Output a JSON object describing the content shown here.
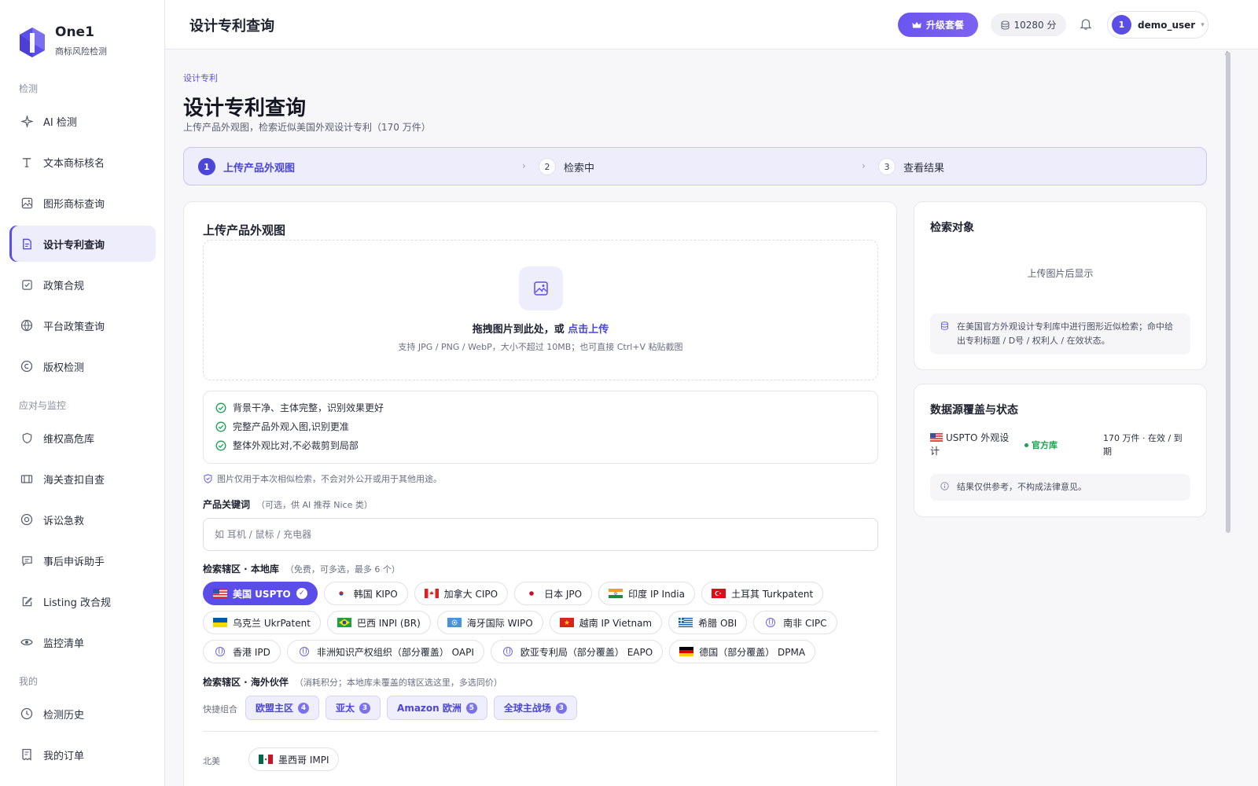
{
  "app": {
    "name": "One1",
    "subtitle": "商标风险检测"
  },
  "sidebar": {
    "groups": [
      {
        "title": "检测",
        "items": [
          {
            "label": "AI 检测",
            "icon": "sparkle-icon"
          },
          {
            "label": "文本商标核名",
            "icon": "text-icon"
          },
          {
            "label": "图形商标查询",
            "icon": "image-icon"
          },
          {
            "label": "设计专利查询",
            "icon": "document-icon",
            "active": true
          },
          {
            "label": "政策合规",
            "icon": "checklist-icon"
          },
          {
            "label": "平台政策查询",
            "icon": "globe-icon"
          },
          {
            "label": "版权检测",
            "icon": "copyright-icon"
          }
        ]
      },
      {
        "title": "应对与监控",
        "items": [
          {
            "label": "维权高危库",
            "icon": "shield-icon"
          },
          {
            "label": "海关查扣自查",
            "icon": "customs-icon"
          },
          {
            "label": "诉讼急救",
            "icon": "lifebuoy-icon"
          },
          {
            "label": "事后申诉助手",
            "icon": "message-icon"
          },
          {
            "label": "Listing 改合规",
            "icon": "edit-icon"
          },
          {
            "label": "监控清单",
            "icon": "eye-icon"
          }
        ]
      },
      {
        "title": "我的",
        "items": [
          {
            "label": "检测历史",
            "icon": "clock-icon"
          },
          {
            "label": "我的订单",
            "icon": "receipt-icon"
          }
        ]
      }
    ]
  },
  "header": {
    "title": "设计专利查询",
    "upgrade_label": "升级套餐",
    "points": "10280 分",
    "user": {
      "initial": "1",
      "name": "demo_user"
    }
  },
  "page": {
    "breadcrumb": "设计专利",
    "title": "设计专利查询",
    "subtitle": "上传产品外观图，检索近似美国外观设计专利（170 万件）"
  },
  "steps": [
    {
      "num": "1",
      "label": "上传产品外观图",
      "active": true
    },
    {
      "num": "2",
      "label": "检索中"
    },
    {
      "num": "3",
      "label": "查看结果"
    }
  ],
  "upload": {
    "heading": "上传产品外观图",
    "drop_text": "拖拽图片到此处，或",
    "drop_link": "点击上传",
    "drop_hint": "支持 JPG / PNG / WebP，大小不超过 10MB；也可直接 Ctrl+V 粘贴截图",
    "tips": [
      "背景干净、主体完整，识别效果更好",
      "完整产品外观入图,识别更准",
      "整体外观比对,不必裁剪到局部"
    ],
    "privacy": "图片仅用于本次相似检索，不会对外公开或用于其他用途。"
  },
  "keyword": {
    "label": "产品关键词",
    "hint": "（可选，供 AI 推荐 Nice 类）",
    "placeholder": "如 耳机 / 鼠标 / 充电器"
  },
  "local_db": {
    "label": "检索辖区 · 本地库",
    "hint": "（免费，可多选，最多 6 个）",
    "rows": [
      [
        {
          "label": "美国 USPTO",
          "flag": "us",
          "selected": true
        },
        {
          "label": "韩国 KIPO",
          "flag": "kr"
        },
        {
          "label": "加拿大 CIPO",
          "flag": "ca"
        },
        {
          "label": "日本 JPO",
          "flag": "jp"
        },
        {
          "label": "印度 IP India",
          "flag": "in"
        },
        {
          "label": "土耳其 Turkpatent",
          "flag": "tr"
        }
      ],
      [
        {
          "label": "乌克兰 UkrPatent",
          "flag": "ua"
        },
        {
          "label": "巴西 INPI (BR)",
          "flag": "br"
        },
        {
          "label": "海牙国际 WIPO",
          "flag": "un"
        },
        {
          "label": "越南 IP Vietnam",
          "flag": "vn"
        },
        {
          "label": "希腊 OBI",
          "flag": "gr"
        },
        {
          "label": "南非 CIPC",
          "flag": "globe"
        }
      ],
      [
        {
          "label": "香港 IPD",
          "flag": "globe"
        },
        {
          "label": "非洲知识产权组织（部分覆盖） OAPI",
          "flag": "globe"
        },
        {
          "label": "欧亚专利局（部分覆盖） EAPO",
          "flag": "globe"
        },
        {
          "label": "德国（部分覆盖） DPMA",
          "flag": "de"
        }
      ]
    ]
  },
  "partners": {
    "label": "检索辖区 · 海外伙伴",
    "hint": "（消耗积分；本地库未覆盖的辖区选这里，多选同价）",
    "combo_label": "快捷组合",
    "combos": [
      {
        "label": "欧盟主区",
        "count": "4"
      },
      {
        "label": "亚太",
        "count": "3"
      },
      {
        "label": "Amazon 欧洲",
        "count": "5"
      },
      {
        "label": "全球主战场",
        "count": "3"
      }
    ],
    "region": "北美",
    "region_chips": [
      {
        "label": "墨西哥 IMPI",
        "flag": "mx"
      }
    ]
  },
  "target": {
    "heading": "检索对象",
    "empty": "上传图片后显示",
    "info": "在美国官方外观设计专利库中进行图形近似检索；命中给出专利标题 / D号 / 权利人 / 在效状态。"
  },
  "datasource": {
    "heading": "数据源覆盖与状态",
    "name": "USPTO 外观设计",
    "badge": "官方库",
    "status": "170 万件 · 在效 / 到期",
    "note": "结果仅供参考，不构成法律意见。"
  },
  "colors": {
    "accent": "#5b4ee8",
    "success": "#16a34a"
  }
}
